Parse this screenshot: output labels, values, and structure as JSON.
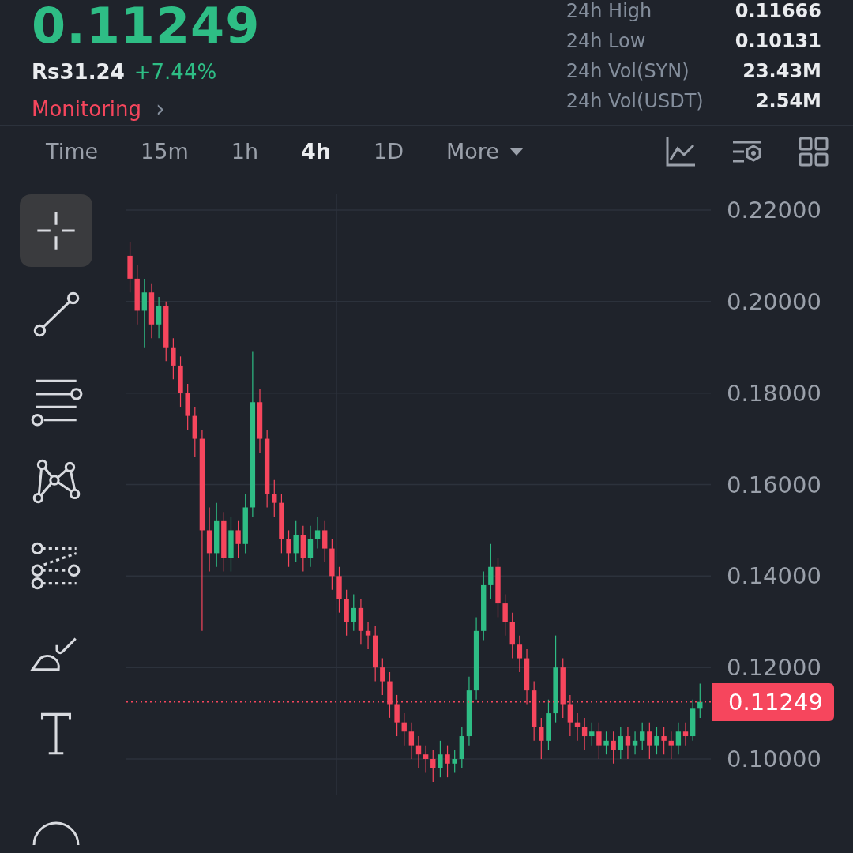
{
  "price": {
    "last": "0.11249",
    "fiat": "Rs31.24",
    "change": "+7.44%",
    "alert_link": "Monitoring",
    "chevron": "›"
  },
  "stats": [
    {
      "label": "24h High",
      "value": "0.11666"
    },
    {
      "label": "24h Low",
      "value": "0.10131"
    },
    {
      "label": "24h Vol(SYN)",
      "value": "23.43M"
    },
    {
      "label": "24h Vol(USDT)",
      "value": "2.54M"
    }
  ],
  "intervals": [
    {
      "label": "Time",
      "selected": false
    },
    {
      "label": "15m",
      "selected": false
    },
    {
      "label": "1h",
      "selected": false
    },
    {
      "label": "4h",
      "selected": true
    },
    {
      "label": "1D",
      "selected": false
    },
    {
      "label": "More",
      "selected": false,
      "dropdown": true
    }
  ],
  "drawing_tools": [
    {
      "kind": "crosshair",
      "selected": true
    },
    {
      "kind": "line",
      "selected": false
    },
    {
      "kind": "parallel",
      "selected": false
    },
    {
      "kind": "pattern",
      "selected": false
    },
    {
      "kind": "fib",
      "selected": false
    },
    {
      "kind": "brush",
      "selected": false
    },
    {
      "kind": "text",
      "selected": false
    },
    {
      "kind": "shape",
      "selected": false
    }
  ],
  "chart": {
    "chart_data": {
      "type": "candlestick",
      "ylim": [
        0.1,
        0.22
      ],
      "grid": true,
      "ref_lines": [
        {
          "axis": "y",
          "value": 0.11249,
          "label": "0.11249"
        }
      ],
      "yticks": [
        {
          "value": 0.22,
          "label": "0.22000"
        },
        {
          "value": 0.2,
          "label": "0.20000"
        },
        {
          "value": 0.18,
          "label": "0.18000"
        },
        {
          "value": 0.16,
          "label": "0.16000"
        },
        {
          "value": 0.14,
          "label": "0.14000"
        },
        {
          "value": 0.12,
          "label": "0.12000"
        },
        {
          "value": 0.1,
          "label": "0.10000"
        }
      ],
      "ohlc": [
        [
          0.21,
          0.213,
          0.202,
          0.205
        ],
        [
          0.205,
          0.208,
          0.195,
          0.198
        ],
        [
          0.198,
          0.205,
          0.19,
          0.202
        ],
        [
          0.202,
          0.204,
          0.192,
          0.195
        ],
        [
          0.195,
          0.201,
          0.192,
          0.199
        ],
        [
          0.199,
          0.2,
          0.187,
          0.19
        ],
        [
          0.19,
          0.192,
          0.183,
          0.186
        ],
        [
          0.186,
          0.188,
          0.177,
          0.18
        ],
        [
          0.18,
          0.182,
          0.172,
          0.175
        ],
        [
          0.175,
          0.177,
          0.166,
          0.17
        ],
        [
          0.17,
          0.172,
          0.128,
          0.15
        ],
        [
          0.15,
          0.155,
          0.141,
          0.145
        ],
        [
          0.145,
          0.156,
          0.142,
          0.152
        ],
        [
          0.152,
          0.154,
          0.141,
          0.144
        ],
        [
          0.144,
          0.153,
          0.141,
          0.15
        ],
        [
          0.15,
          0.152,
          0.144,
          0.147
        ],
        [
          0.147,
          0.158,
          0.145,
          0.155
        ],
        [
          0.155,
          0.189,
          0.153,
          0.178
        ],
        [
          0.178,
          0.181,
          0.167,
          0.17
        ],
        [
          0.17,
          0.172,
          0.155,
          0.158
        ],
        [
          0.158,
          0.161,
          0.153,
          0.156
        ],
        [
          0.156,
          0.158,
          0.145,
          0.148
        ],
        [
          0.148,
          0.15,
          0.142,
          0.145
        ],
        [
          0.145,
          0.152,
          0.143,
          0.149
        ],
        [
          0.149,
          0.151,
          0.141,
          0.144
        ],
        [
          0.144,
          0.151,
          0.142,
          0.148
        ],
        [
          0.148,
          0.153,
          0.146,
          0.15
        ],
        [
          0.15,
          0.152,
          0.143,
          0.146
        ],
        [
          0.146,
          0.148,
          0.137,
          0.14
        ],
        [
          0.14,
          0.142,
          0.132,
          0.135
        ],
        [
          0.135,
          0.137,
          0.127,
          0.13
        ],
        [
          0.13,
          0.136,
          0.128,
          0.133
        ],
        [
          0.133,
          0.135,
          0.125,
          0.128
        ],
        [
          0.128,
          0.13,
          0.124,
          0.127
        ],
        [
          0.127,
          0.129,
          0.117,
          0.12
        ],
        [
          0.12,
          0.122,
          0.114,
          0.117
        ],
        [
          0.117,
          0.119,
          0.109,
          0.112
        ],
        [
          0.112,
          0.114,
          0.105,
          0.108
        ],
        [
          0.108,
          0.11,
          0.103,
          0.106
        ],
        [
          0.106,
          0.108,
          0.1,
          0.103
        ],
        [
          0.103,
          0.105,
          0.098,
          0.101
        ],
        [
          0.101,
          0.103,
          0.097,
          0.1
        ],
        [
          0.1,
          0.102,
          0.095,
          0.098
        ],
        [
          0.098,
          0.104,
          0.096,
          0.101
        ],
        [
          0.101,
          0.103,
          0.096,
          0.099
        ],
        [
          0.099,
          0.102,
          0.097,
          0.1
        ],
        [
          0.1,
          0.107,
          0.098,
          0.105
        ],
        [
          0.105,
          0.118,
          0.103,
          0.115
        ],
        [
          0.115,
          0.131,
          0.113,
          0.128
        ],
        [
          0.128,
          0.141,
          0.126,
          0.138
        ],
        [
          0.138,
          0.147,
          0.135,
          0.142
        ],
        [
          0.142,
          0.144,
          0.131,
          0.134
        ],
        [
          0.134,
          0.136,
          0.127,
          0.13
        ],
        [
          0.13,
          0.132,
          0.122,
          0.125
        ],
        [
          0.125,
          0.127,
          0.119,
          0.122
        ],
        [
          0.122,
          0.124,
          0.112,
          0.115
        ],
        [
          0.115,
          0.117,
          0.104,
          0.107
        ],
        [
          0.107,
          0.109,
          0.1,
          0.104
        ],
        [
          0.104,
          0.113,
          0.102,
          0.11
        ],
        [
          0.11,
          0.127,
          0.108,
          0.12
        ],
        [
          0.12,
          0.122,
          0.109,
          0.112
        ],
        [
          0.112,
          0.114,
          0.105,
          0.108
        ],
        [
          0.108,
          0.11,
          0.104,
          0.107
        ],
        [
          0.107,
          0.109,
          0.102,
          0.105
        ],
        [
          0.105,
          0.108,
          0.103,
          0.106
        ],
        [
          0.106,
          0.108,
          0.1,
          0.103
        ],
        [
          0.103,
          0.106,
          0.101,
          0.104
        ],
        [
          0.104,
          0.106,
          0.099,
          0.102
        ],
        [
          0.102,
          0.107,
          0.1,
          0.105
        ],
        [
          0.105,
          0.107,
          0.1,
          0.103
        ],
        [
          0.103,
          0.106,
          0.101,
          0.104
        ],
        [
          0.104,
          0.108,
          0.102,
          0.106
        ],
        [
          0.106,
          0.108,
          0.1,
          0.103
        ],
        [
          0.103,
          0.107,
          0.101,
          0.105
        ],
        [
          0.105,
          0.107,
          0.101,
          0.104
        ],
        [
          0.104,
          0.106,
          0.1,
          0.103
        ],
        [
          0.103,
          0.108,
          0.101,
          0.106
        ],
        [
          0.106,
          0.108,
          0.103,
          0.105
        ],
        [
          0.105,
          0.113,
          0.104,
          0.111
        ],
        [
          0.111,
          0.1165,
          0.109,
          0.11249
        ]
      ]
    }
  }
}
